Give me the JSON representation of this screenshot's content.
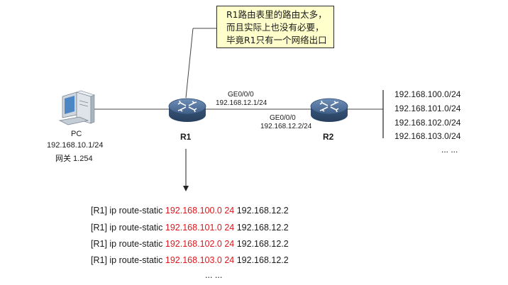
{
  "callout": {
    "lines": [
      "R1路由表里的路由太多，",
      "而且实际上也没有必要，",
      "毕竟R1只有一个网络出口"
    ]
  },
  "pc": {
    "icon": "pc-icon",
    "name": "PC",
    "ip": "192.168.10.1/24",
    "gateway": "网关 1.254"
  },
  "r1": {
    "icon": "router-icon",
    "name": "R1",
    "interface": "GE0/0/0",
    "ip": "192.168.12.1/24"
  },
  "r2": {
    "icon": "router-icon",
    "name": "R2",
    "interface": "GE0/0/0",
    "ip": "192.168.12.2/24"
  },
  "networks": [
    "192.168.100.0/24",
    "192.168.101.0/24",
    "192.168.102.0/24",
    "192.168.103.0/24",
    "... ..."
  ],
  "commands": [
    {
      "prefix": "[R1] ip route-static ",
      "dest": "192.168.100.0 24",
      "nexthop": " 192.168.12.2"
    },
    {
      "prefix": "[R1] ip route-static ",
      "dest": "192.168.101.0 24",
      "nexthop": " 192.168.12.2"
    },
    {
      "prefix": "[R1] ip route-static ",
      "dest": "192.168.102.0 24",
      "nexthop": " 192.168.12.2"
    },
    {
      "prefix": "[R1] ip route-static ",
      "dest": "192.168.103.0 24",
      "nexthop": " 192.168.12.2"
    }
  ],
  "commands_more": "... ...",
  "colors": {
    "highlight": "#e0161b",
    "callout_bg": "#ffffcc",
    "router": "#4a6c96"
  }
}
